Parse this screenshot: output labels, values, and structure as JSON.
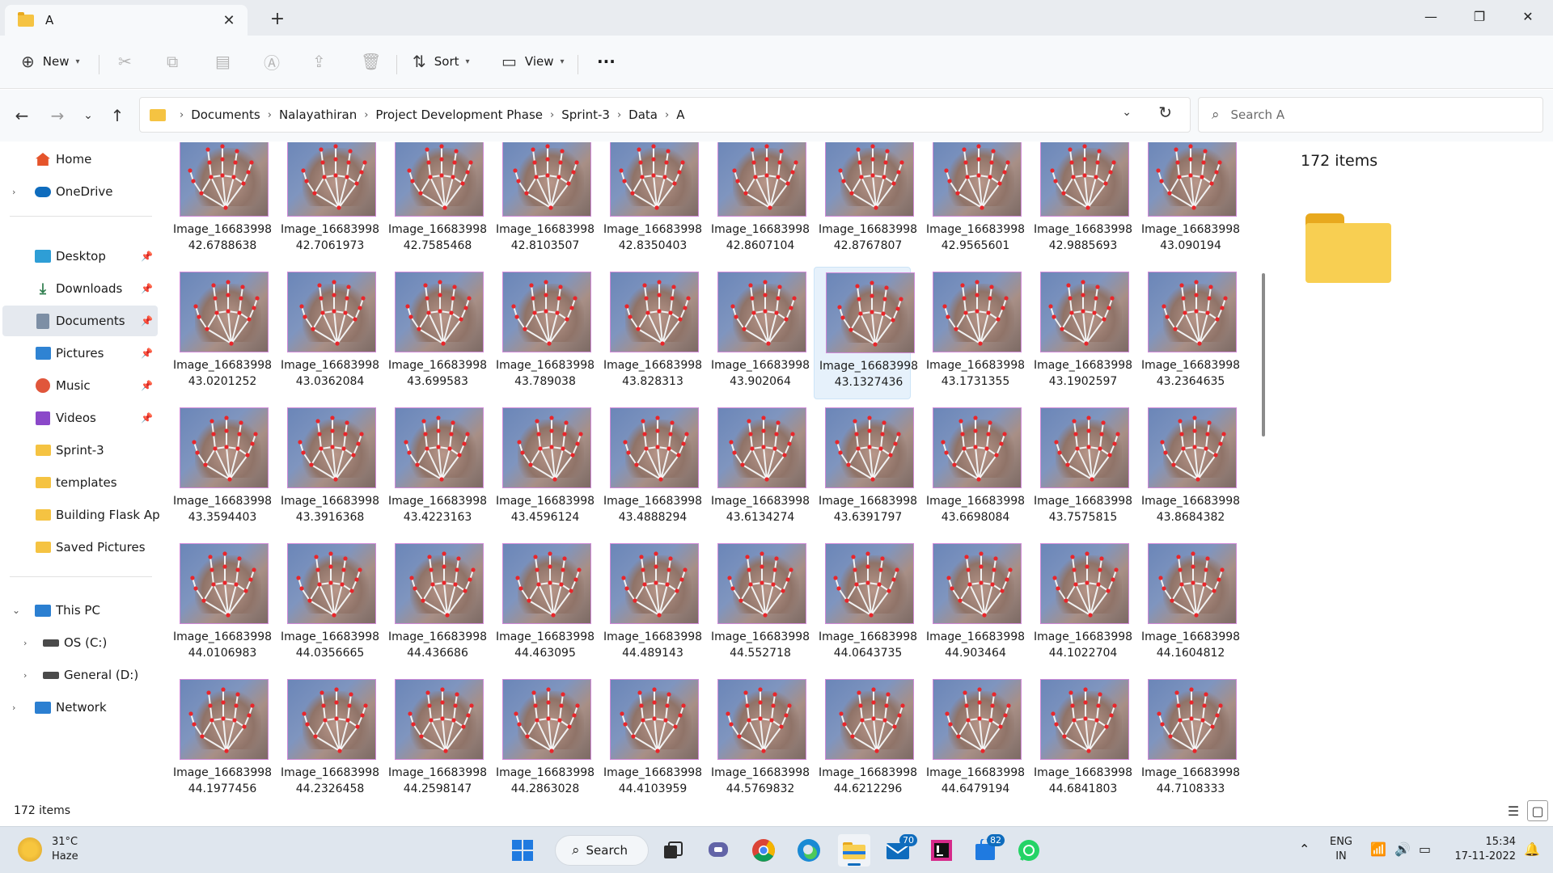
{
  "window": {
    "tab_title": "A",
    "tab_close": "✕",
    "tab_add": "+",
    "minimize": "—",
    "maximize": "❐",
    "close": "✕"
  },
  "toolbar": {
    "new_label": "New",
    "sort_label": "Sort",
    "view_label": "View",
    "more_label": "···"
  },
  "address": {
    "breadcrumbs": [
      "Documents",
      "Nalayathiran",
      "Project Development Phase",
      "Sprint-3",
      "Data",
      "A"
    ],
    "search_placeholder": "Search A"
  },
  "sidebar": {
    "home": "Home",
    "onedrive": "OneDrive",
    "quick_access": [
      "Desktop",
      "Downloads",
      "Documents",
      "Pictures",
      "Music",
      "Videos"
    ],
    "folders": [
      "Sprint-3",
      "templates",
      "Building Flask Appl",
      "Saved Pictures"
    ],
    "this_pc": "This PC",
    "drives": [
      "OS (C:)",
      "General (D:)"
    ],
    "network": "Network"
  },
  "files": [
    [
      "Image_16683998",
      "42.6788638"
    ],
    [
      "Image_16683998",
      "42.7061973"
    ],
    [
      "Image_16683998",
      "42.7585468"
    ],
    [
      "Image_16683998",
      "42.8103507"
    ],
    [
      "Image_16683998",
      "42.8350403"
    ],
    [
      "Image_16683998",
      "42.8607104"
    ],
    [
      "Image_16683998",
      "42.8767807"
    ],
    [
      "Image_16683998",
      "42.9565601"
    ],
    [
      "Image_16683998",
      "42.9885693"
    ],
    [
      "Image_16683998",
      "43.090194"
    ],
    [
      "Image_16683998",
      "43.0201252"
    ],
    [
      "Image_16683998",
      "43.0362084"
    ],
    [
      "Image_16683998",
      "43.699583"
    ],
    [
      "Image_16683998",
      "43.789038"
    ],
    [
      "Image_16683998",
      "43.828313"
    ],
    [
      "Image_16683998",
      "43.902064"
    ],
    [
      "Image_16683998",
      "43.1327436"
    ],
    [
      "Image_16683998",
      "43.1731355"
    ],
    [
      "Image_16683998",
      "43.1902597"
    ],
    [
      "Image_16683998",
      "43.2364635"
    ],
    [
      "Image_16683998",
      "43.3594403"
    ],
    [
      "Image_16683998",
      "43.3916368"
    ],
    [
      "Image_16683998",
      "43.4223163"
    ],
    [
      "Image_16683998",
      "43.4596124"
    ],
    [
      "Image_16683998",
      "43.4888294"
    ],
    [
      "Image_16683998",
      "43.6134274"
    ],
    [
      "Image_16683998",
      "43.6391797"
    ],
    [
      "Image_16683998",
      "43.6698084"
    ],
    [
      "Image_16683998",
      "43.7575815"
    ],
    [
      "Image_16683998",
      "43.8684382"
    ],
    [
      "Image_16683998",
      "44.0106983"
    ],
    [
      "Image_16683998",
      "44.0356665"
    ],
    [
      "Image_16683998",
      "44.436686"
    ],
    [
      "Image_16683998",
      "44.463095"
    ],
    [
      "Image_16683998",
      "44.489143"
    ],
    [
      "Image_16683998",
      "44.552718"
    ],
    [
      "Image_16683998",
      "44.0643735"
    ],
    [
      "Image_16683998",
      "44.903464"
    ],
    [
      "Image_16683998",
      "44.1022704"
    ],
    [
      "Image_16683998",
      "44.1604812"
    ],
    [
      "Image_16683998",
      "44.1977456"
    ],
    [
      "Image_16683998",
      "44.2326458"
    ],
    [
      "Image_16683998",
      "44.2598147"
    ],
    [
      "Image_16683998",
      "44.2863028"
    ],
    [
      "Image_16683998",
      "44.4103959"
    ],
    [
      "Image_16683998",
      "44.5769832"
    ],
    [
      "Image_16683998",
      "44.6212296"
    ],
    [
      "Image_16683998",
      "44.6479194"
    ],
    [
      "Image_16683998",
      "44.6841803"
    ],
    [
      "Image_16683998",
      "44.7108333"
    ]
  ],
  "selected_file_index": 16,
  "details": {
    "item_count": "172 items"
  },
  "status": {
    "item_count": "172 items"
  },
  "taskbar": {
    "weather_temp": "31°C",
    "weather_desc": "Haze",
    "search_label": "Search",
    "mail_badge": "70",
    "store_badge": "82",
    "lang_line1": "ENG",
    "lang_line2": "IN",
    "time": "15:34",
    "date": "17-11-2022"
  },
  "icons": {
    "new": "plus-circle-icon",
    "cut": "scissors-icon",
    "copy": "copy-icon",
    "paste": "clipboard-icon",
    "rename": "rename-icon",
    "share": "share-icon",
    "delete": "trash-icon",
    "sort": "sort-icon",
    "view": "view-icon"
  },
  "colors": {
    "accent": "#0f6cbd",
    "folder": "#f5c342",
    "selection": "#e6f1fb"
  }
}
